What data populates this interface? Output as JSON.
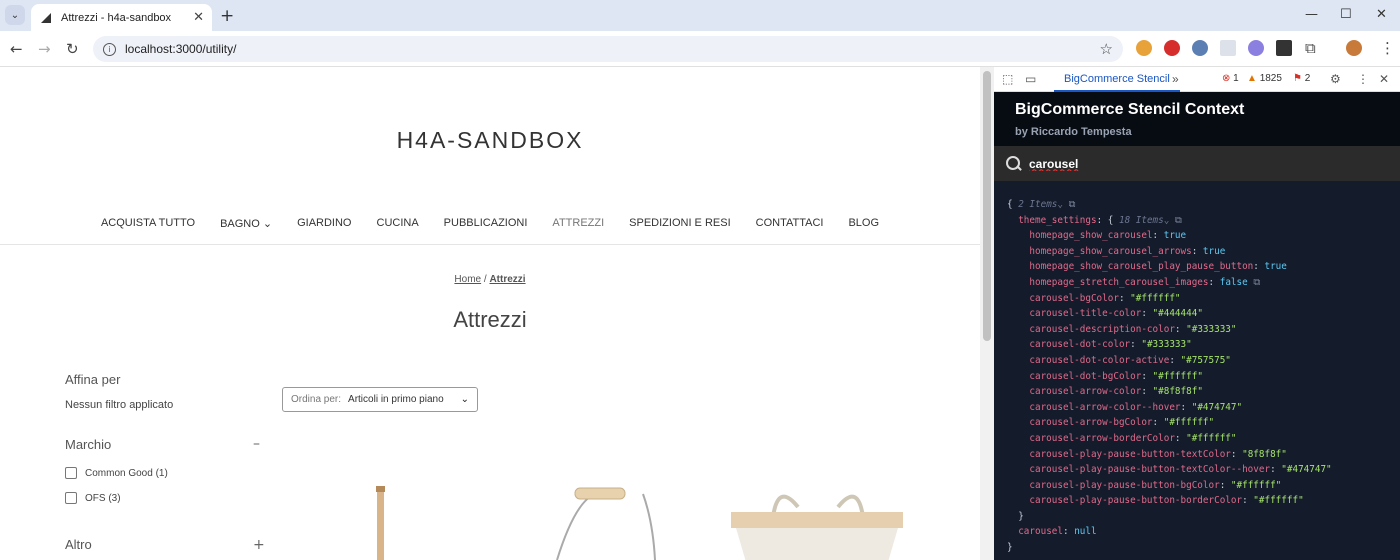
{
  "browser": {
    "tab_title": "Attrezzi - h4a-sandbox",
    "url": "localhost:3000/utility/",
    "new_tab": "+",
    "tab_close": "✕"
  },
  "store": {
    "title": "H4A-SANDBOX",
    "nav": [
      "ACQUISTA TUTTO",
      "BAGNO",
      "GIARDINO",
      "CUCINA",
      "PUBBLICAZIONI",
      "ATTREZZI",
      "SPEDIZIONI E RESI",
      "CONTATTACI",
      "BLOG"
    ],
    "breadcrumb": {
      "home": "Home",
      "sep": "/",
      "current": "Attrezzi"
    },
    "page_title": "Attrezzi",
    "sidebar": {
      "refine_heading": "Affina per",
      "no_filter": "Nessun filtro applicato",
      "brand_heading": "Marchio",
      "brand_toggle": "–",
      "brands": [
        "Common Good (1)",
        "OFS (3)"
      ],
      "other_heading": "Altro",
      "other_toggle": "+"
    },
    "sort": {
      "label": "Ordina per:",
      "value": "Articoli in primo piano"
    }
  },
  "devtools": {
    "tab": "BigCommerce Stencil",
    "more": "»",
    "errors": "1",
    "warnings": "1825",
    "issues": "2",
    "panel_title": "BigCommerce Stencil Context",
    "panel_author": "by Riccardo Tempesta",
    "search_value": "carousel",
    "root_meta": "2 Items",
    "theme_key": "theme_settings",
    "theme_meta": "18 Items",
    "settings": [
      {
        "k": "homepage_show_carousel",
        "v": "true",
        "t": "bool"
      },
      {
        "k": "homepage_show_carousel_arrows",
        "v": "true",
        "t": "bool"
      },
      {
        "k": "homepage_show_carousel_play_pause_button",
        "v": "true",
        "t": "bool"
      },
      {
        "k": "homepage_stretch_carousel_images",
        "v": "false",
        "t": "bool"
      },
      {
        "k": "carousel-bgColor",
        "v": "\"#ffffff\"",
        "t": "str"
      },
      {
        "k": "carousel-title-color",
        "v": "\"#444444\"",
        "t": "str"
      },
      {
        "k": "carousel-description-color",
        "v": "\"#333333\"",
        "t": "str"
      },
      {
        "k": "carousel-dot-color",
        "v": "\"#333333\"",
        "t": "str"
      },
      {
        "k": "carousel-dot-color-active",
        "v": "\"#757575\"",
        "t": "str"
      },
      {
        "k": "carousel-dot-bgColor",
        "v": "\"#ffffff\"",
        "t": "str"
      },
      {
        "k": "carousel-arrow-color",
        "v": "\"#8f8f8f\"",
        "t": "str"
      },
      {
        "k": "carousel-arrow-color--hover",
        "v": "\"#474747\"",
        "t": "str"
      },
      {
        "k": "carousel-arrow-bgColor",
        "v": "\"#ffffff\"",
        "t": "str"
      },
      {
        "k": "carousel-arrow-borderColor",
        "v": "\"#ffffff\"",
        "t": "str"
      },
      {
        "k": "carousel-play-pause-button-textColor",
        "v": "\"8f8f8f\"",
        "t": "str"
      },
      {
        "k": "carousel-play-pause-button-textColor--hover",
        "v": "\"#474747\"",
        "t": "str"
      },
      {
        "k": "carousel-play-pause-button-bgColor",
        "v": "\"#ffffff\"",
        "t": "str"
      },
      {
        "k": "carousel-play-pause-button-borderColor",
        "v": "\"#ffffff\"",
        "t": "str"
      }
    ],
    "carousel_key": "carousel",
    "carousel_val": "null"
  }
}
